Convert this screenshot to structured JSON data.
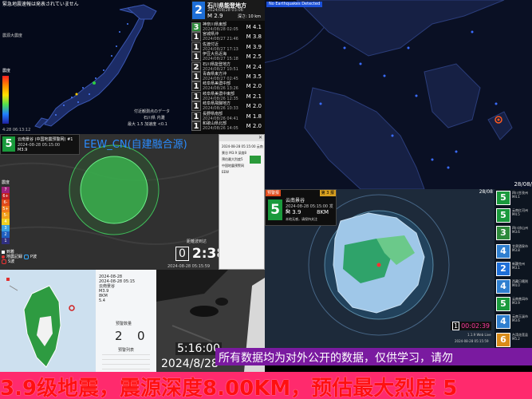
{
  "japan_panel": {
    "warning_text": "緊急地震速報は発表されていません",
    "region_label": "震源大震度",
    "scale_title": "震度",
    "scale_sub": "震度",
    "obs_note1": "付近観測点のデータ",
    "obs_place": "石川県 内灘",
    "obs_values": "最大 1.5 加速度 <0.1",
    "clock": "4:28 06:13:12"
  },
  "jma_list": {
    "header_int": "2",
    "header_place": "石川県能登地方",
    "header_time": "2024/08/28 03:06",
    "header_mag": "M 2.9",
    "header_depth": "深さ: 10 km",
    "items": [
      {
        "int": "3",
        "place": "神奈川県東部",
        "time": "2024/08/28 02:05",
        "mag": "M 4.1"
      },
      {
        "int": "1",
        "place": "宮城県沖",
        "time": "2024/08/27 21:46",
        "mag": "M 3.8"
      },
      {
        "int": "1",
        "place": "佐渡付近",
        "time": "2024/08/27 17:13",
        "mag": "M 3.9"
      },
      {
        "int": "1",
        "place": "伊豆大島近海",
        "time": "2024/08/27 15:18",
        "mag": "M 2.5"
      },
      {
        "int": "2",
        "place": "石川県能登地方",
        "time": "2024/08/27 10:51",
        "mag": "M 2.4"
      },
      {
        "int": "1",
        "place": "青森県東方沖",
        "time": "2024/08/27 02:45",
        "mag": "M 3.5"
      },
      {
        "int": "1",
        "place": "岐阜県美濃中部",
        "time": "2024/08/26 13:26",
        "mag": "M 2.0"
      },
      {
        "int": "1",
        "place": "岐阜県美濃中東部",
        "time": "2024/08/26 12:35",
        "mag": "M 2.1"
      },
      {
        "int": "1",
        "place": "岐阜県飛騨地方",
        "time": "2024/08/26 10:33",
        "mag": "M 2.0"
      },
      {
        "int": "1",
        "place": "長野県南部",
        "time": "2024/08/26 04:41",
        "mag": "M 1.8"
      },
      {
        "int": "1",
        "place": "和歌山県北部",
        "time": "2024/08/26 14:05",
        "mag": "M 2.0"
      }
    ]
  },
  "globe_panel": {
    "status": "No Earthquakes Detected",
    "corner_date": "28/08/"
  },
  "eew_panel": {
    "badge_int": "5",
    "region": "云南景谷 (中国地震预警网) #1",
    "time": "2024-08-28 05:15:00",
    "mag": "M3.9",
    "overlay_title": "EEW_CN(自建融合源)",
    "legend_title": "震度",
    "legend": [
      "7",
      "6+",
      "6-",
      "5+",
      "5-",
      "4",
      "3",
      "2",
      "1"
    ],
    "key1": "到着",
    "key2": "地震記録",
    "key3": "P波",
    "key4": "S波",
    "countdown_digit": "0",
    "countdown_time": "2:38",
    "countdown_label": "距離波到达",
    "stamp": "2024-08-28 05:15:59"
  },
  "popup": {
    "lines": [
      "2024-08-28 05:15:00 云南",
      "景谷 M3.9 深度8",
      "预估最大烈度5",
      "中国地震预警网",
      "EEW"
    ]
  },
  "taiwan_panel": {
    "info": [
      "2024-08-28",
      "2024-08-28 05:15",
      "云南景谷",
      "M3.9",
      "8KM",
      "5.4"
    ],
    "count_title": "预警数量",
    "count_a": "2",
    "count_b": "0",
    "list_title": "预警列表",
    "list_label": "震中"
  },
  "camera": {
    "time": "5:16:00",
    "date": "2024/8/28"
  },
  "china_panel": {
    "warn_label": "预警报",
    "report_no": "第 3 报",
    "int": "5",
    "region": "云南景谷",
    "time": "2024-08-28 05:15:00 发生",
    "mag": "M 3.9",
    "depth": "8KM",
    "note": "本地无感，请保持关注",
    "corner_date": "28/08",
    "cd_digit": "1",
    "cd_time": "00:02:39",
    "version": "1.1.9 Web Live",
    "stamp": "2024-08-28 05:15:59",
    "right_list": [
      {
        "int": "5",
        "place": "四川甘孜州",
        "mag": "M4.1"
      },
      {
        "int": "5",
        "place": "云南红河州",
        "mag": "M4.5"
      },
      {
        "int": "3",
        "place": "四川凉山州",
        "mag": "M3.6"
      },
      {
        "int": "4",
        "place": "甘肃酒泉市",
        "mag": "M3.8"
      },
      {
        "int": "2",
        "place": "新疆克州",
        "mag": "M3.1"
      },
      {
        "int": "4",
        "place": "西藏日喀则",
        "mag": "M4.0"
      },
      {
        "int": "5",
        "place": "云南普洱市",
        "mag": "M3.9"
      },
      {
        "int": "4",
        "place": "云南玉溪市",
        "mag": "M3.6"
      },
      {
        "int": "6",
        "place": "台湾花莲县",
        "mag": "M5.2"
      }
    ]
  },
  "ticker": {
    "notice": "所有数据均为对外公开的数据，仅供学习，请勿",
    "main": "3.9级地震，震源深度8.00KM，预估最大烈度 5"
  },
  "colors": {
    "int1": "#6b6b6b",
    "int2": "#1e6fd8",
    "int3": "#2d8a3a",
    "int4": "#2f7fcf",
    "int5": "#1a9a3c",
    "int6": "#d98c1a",
    "ticker_bg": "#ff2a6d",
    "ticker_main": "#f02020",
    "notice_bg": "#7a1aa0",
    "eew_green": "#1aa14a"
  }
}
